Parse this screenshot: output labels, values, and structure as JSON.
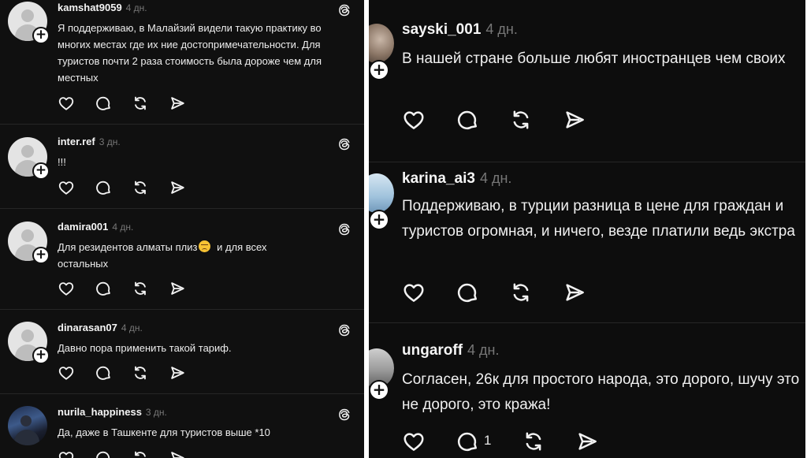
{
  "left_posts": [
    {
      "username": "kamshat9059",
      "time": "4 дн.",
      "text": "Я поддерживаю, в Малайзий видели такую практику во многих местах где их ние достопримечательности. Для туристов почти 2 раза стоимость была дороже чем для местных"
    },
    {
      "username": "inter.ref",
      "time": "3 дн.",
      "text": "!!!"
    },
    {
      "username": "damira001",
      "time": "4 дн.",
      "text_before": "Для резидентов алматы плиз",
      "text_after": " и для всех остальных"
    },
    {
      "username": "dinarasan07",
      "time": "4 дн.",
      "text": "Давно пора применить такой тариф."
    },
    {
      "username": "nurila_happiness",
      "time": "3 дн.",
      "text": "Да, даже в Ташкенте для туристов выше *10"
    }
  ],
  "right_posts": [
    {
      "username": "sayski_001",
      "time": "4 дн.",
      "text": "В нашей стране больше любят иностранцев чем своих"
    },
    {
      "username": "karina_ai3",
      "time": "4 дн.",
      "text": "Поддерживаю, в турции разница в цене для граждан и туристов огромная, и ничего,  везде платили ведь экстра"
    },
    {
      "username": "ungaroff",
      "time": "4 дн.",
      "text": "Согласен, 26к для простого народа, это дорого, шучу это не дорого, это кража!",
      "reply_count": "1"
    }
  ],
  "icons": {
    "like": "heart-icon",
    "reply": "comment-bubble-icon",
    "repost": "repost-icon",
    "share": "send-icon",
    "follow": "plus-icon",
    "brand": "threads-logo-icon"
  },
  "colors": {
    "background": "#101010",
    "text": "#f2f2f2",
    "muted": "#777777",
    "divider": "#262626"
  }
}
